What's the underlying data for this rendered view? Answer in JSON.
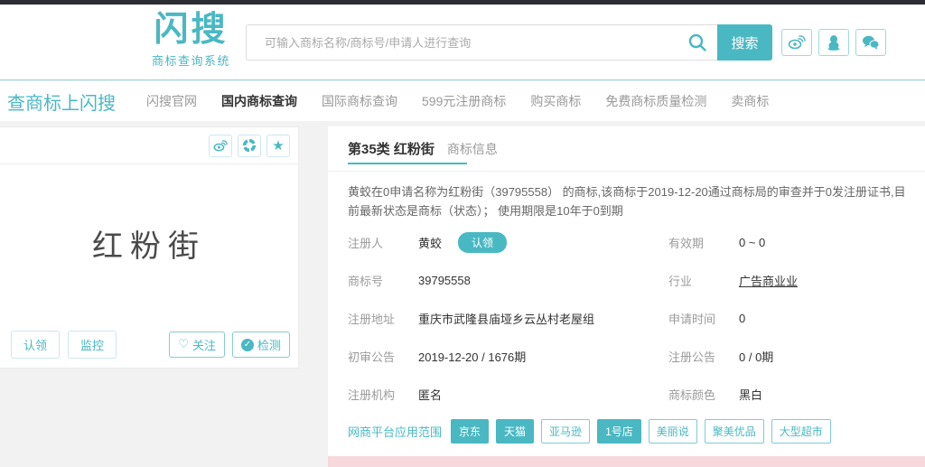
{
  "theme": {
    "teal": "#49b8c2",
    "dark_bar": "#2b2d33",
    "pink": "#f6d8dd"
  },
  "header": {
    "logo_text": "闪搜",
    "logo_subtitle": "商标查询系统",
    "search_placeholder": "可输入商标名称/商标号/申请人进行查询",
    "search_button": "搜索",
    "social_icons": [
      "weibo-icon",
      "qq-icon",
      "wechat-icon"
    ]
  },
  "nav": {
    "slogan": "查商标上闪搜",
    "items": [
      {
        "label": "闪搜官网",
        "active": false
      },
      {
        "label": "国内商标查询",
        "active": true
      },
      {
        "label": "国际商标查询",
        "active": false
      },
      {
        "label": "599元注册商标",
        "active": false
      },
      {
        "label": "购买商标",
        "active": false
      },
      {
        "label": "免费商标质量检测",
        "active": false
      },
      {
        "label": "卖商标",
        "active": false
      }
    ]
  },
  "left_panel": {
    "share_icons": [
      "weibo-icon",
      "wechat-moments-icon",
      "star-icon"
    ],
    "trademark_text": "红粉街",
    "claim_button": "认领",
    "monitor_button": "监控",
    "follow_button": "关注",
    "detect_button": "检测"
  },
  "detail": {
    "title": "第35类 红粉街",
    "subtitle": "商标信息",
    "description": "黄蛟在0申请名称为红粉街（39795558） 的商标,该商标于2019-12-20通过商标局的审查并于0发注册证书,目前最新状态是商标（状态）； 使用期限是10年于0到期",
    "fields_left": [
      {
        "label": "注册人",
        "value": "黄蛟",
        "badge": "认领"
      },
      {
        "label": "商标号",
        "value": "39795558"
      },
      {
        "label": "注册地址",
        "value": "重庆市武隆县庙垭乡云丛村老屋组"
      },
      {
        "label": "初审公告",
        "value": "2019-12-20 / 1676期"
      },
      {
        "label": "注册机构",
        "value": "匿名"
      }
    ],
    "fields_right": [
      {
        "label": "有效期",
        "value": "0 ~ 0"
      },
      {
        "label": "行业",
        "value": "广告商业业",
        "link": true
      },
      {
        "label": "申请时间",
        "value": "0"
      },
      {
        "label": "注册公告",
        "value": "0 / 0期"
      },
      {
        "label": "商标颜色",
        "value": "黑白"
      }
    ],
    "platforms_label": "网商平台应用范围",
    "platforms": [
      {
        "label": "京东",
        "filled": true
      },
      {
        "label": "天猫",
        "filled": true
      },
      {
        "label": "亚马逊",
        "filled": false
      },
      {
        "label": "1号店",
        "filled": true
      },
      {
        "label": "美丽说",
        "filled": false
      },
      {
        "label": "聚美优品",
        "filled": false
      },
      {
        "label": "大型超市",
        "filled": false
      }
    ]
  }
}
